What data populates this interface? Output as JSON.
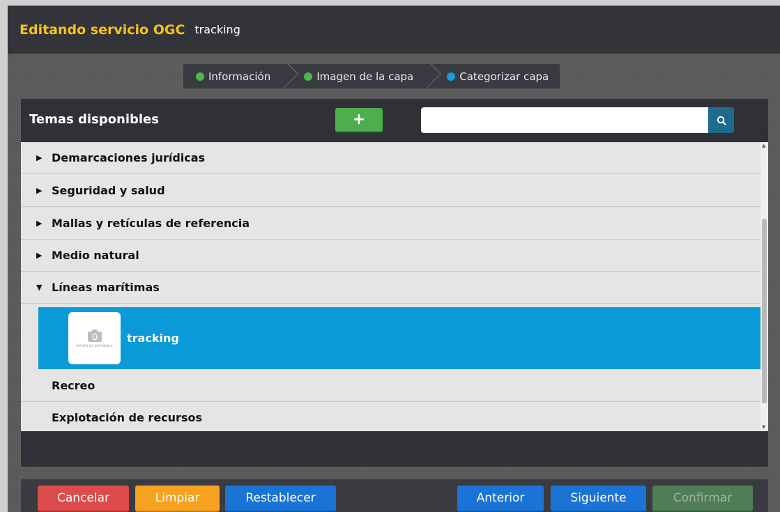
{
  "header": {
    "title": "Editando servicio OGC",
    "subtitle": "tracking"
  },
  "steps": [
    {
      "label": "Información",
      "status_color": "#4cb84c"
    },
    {
      "label": "Imagen de la capa",
      "status_color": "#4cb84c"
    },
    {
      "label": "Categorizar capa",
      "status_color": "#1a9be0"
    }
  ],
  "panel": {
    "title": "Temas disponibles",
    "add_icon": "plus-icon",
    "search_placeholder": "",
    "search_icon": "search-icon"
  },
  "topics": [
    {
      "label": "Demarcaciones jurídicas",
      "state": "collapsed"
    },
    {
      "label": "Seguridad y salud",
      "state": "collapsed"
    },
    {
      "label": "Mallas y retículas de referencia",
      "state": "collapsed"
    },
    {
      "label": "Medio natural",
      "state": "collapsed"
    },
    {
      "label": "Líneas marítimas",
      "state": "expanded"
    },
    {
      "label": "Recreo",
      "state": "leaf"
    },
    {
      "label": "Explotación de recursos",
      "state": "leaf"
    }
  ],
  "selected_layer": {
    "label": "tracking",
    "thumb_caption": "IMAGEN NO DISPONIBLE",
    "thumb_icon": "camera-icon"
  },
  "footer": {
    "cancel": "Cancelar",
    "clear": "Limpiar",
    "reset": "Restablecer",
    "previous": "Anterior",
    "next": "Siguiente",
    "confirm": "Confirmar"
  },
  "colors": {
    "title": "#f7c416",
    "selected": "#0a9ad8",
    "cancel": "#de4b4b",
    "clear": "#f7a21e",
    "blue_btn": "#1a74d6",
    "confirm": "#4f7d56"
  }
}
